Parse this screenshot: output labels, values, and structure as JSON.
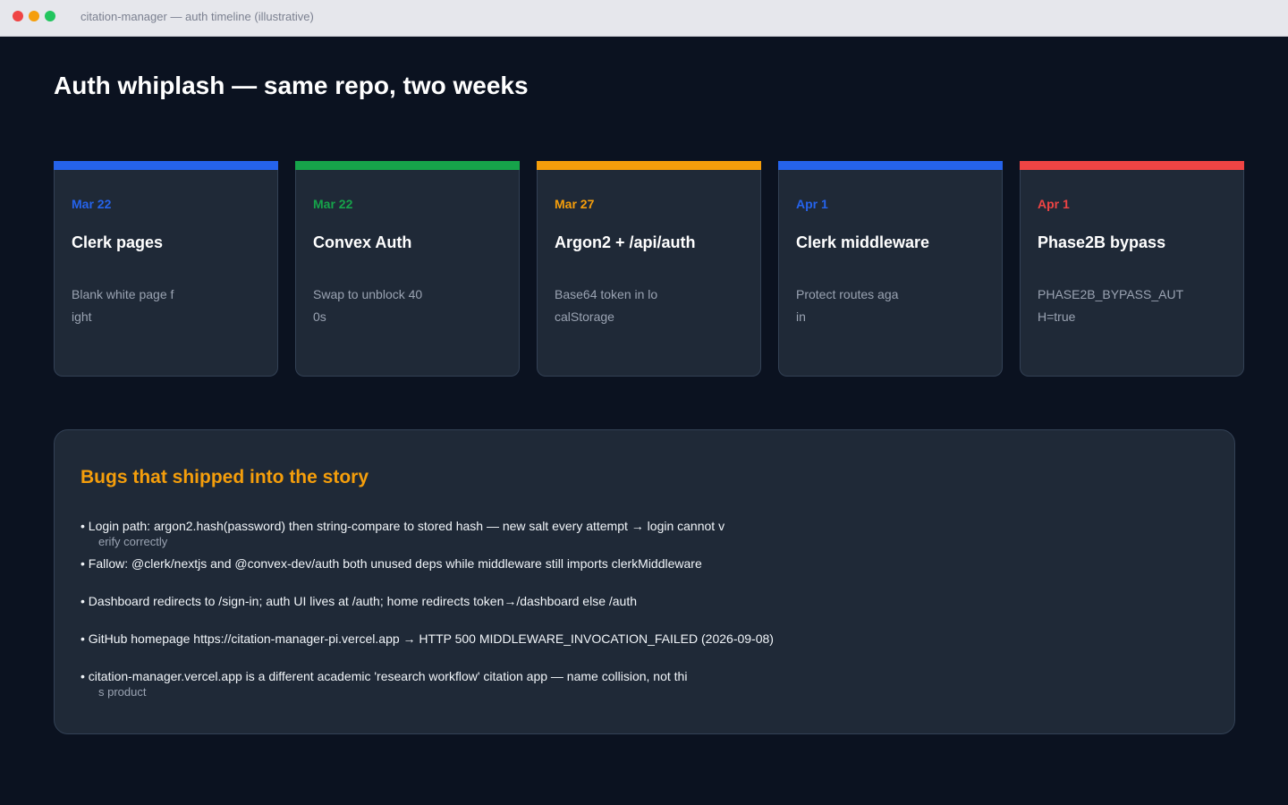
{
  "window": {
    "title": "citation-manager — auth timeline (illustrative)"
  },
  "page": {
    "title": "Auth whiplash — same repo, two weeks"
  },
  "colors": {
    "blue": "#2563eb",
    "green": "#16a34a",
    "amber": "#f59e0b",
    "red": "#ef4444"
  },
  "timeline": [
    {
      "date": "Mar 22",
      "title": "Clerk pages",
      "desc": "Blank white page f\night",
      "color": "#2563eb"
    },
    {
      "date": "Mar 22",
      "title": "Convex Auth",
      "desc": "Swap to unblock 40\n0s",
      "color": "#16a34a"
    },
    {
      "date": "Mar 27",
      "title": "Argon2 + /api/auth",
      "desc": "Base64 token in lo\ncalStorage",
      "color": "#f59e0b"
    },
    {
      "date": "Apr 1",
      "title": "Clerk middleware",
      "desc": "Protect routes aga\nin",
      "color": "#2563eb"
    },
    {
      "date": "Apr 1",
      "title": "Phase2B bypass",
      "desc": "PHASE2B_BYPASS_AUT\nH=true",
      "color": "#ef4444"
    }
  ],
  "bugs": {
    "title": "Bugs that shipped into the story",
    "items": [
      {
        "text": "• Login path: argon2.hash(password) then string-compare to stored hash — new salt every attempt → login cannot v",
        "cont": "erify correctly"
      },
      {
        "text": "• Fallow: @clerk/nextjs and @convex-dev/auth both unused deps while middleware still imports clerkMiddleware",
        "cont": ""
      },
      {
        "text": "• Dashboard redirects to /sign-in; auth UI lives at /auth; home redirects token→/dashboard else /auth",
        "cont": ""
      },
      {
        "text": "• GitHub homepage https://citation-manager-pi.vercel.app → HTTP 500 MIDDLEWARE_INVOCATION_FAILED (2026-09-08)",
        "cont": ""
      },
      {
        "text": "• citation-manager.vercel.app is a different academic 'research workflow' citation app — name collision, not thi",
        "cont": "s product"
      }
    ]
  }
}
